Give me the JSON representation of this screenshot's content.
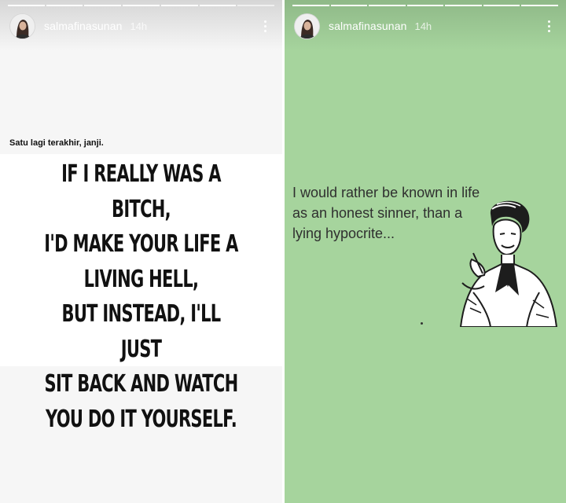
{
  "stories": [
    {
      "username": "salmafinasunan",
      "time": "14h",
      "caption": "Satu lagi terakhir, janji.",
      "quote_lines": [
        "IF I REALLY WAS A BITCH,",
        "I'D MAKE YOUR LIFE A",
        "LIVING HELL,",
        "BUT INSTEAD, I'LL JUST",
        "SIT BACK AND WATCH",
        "YOU DO IT YOURSELF."
      ],
      "background": "#f6f6f6"
    },
    {
      "username": "salmafinasunan",
      "time": "14h",
      "text_lines": [
        "I would rather be known in life",
        "as an honest sinner, than a",
        "lying hypocrite..."
      ],
      "background": "#a6d49d"
    }
  ],
  "icons": [
    "avatar",
    "more-options-icon"
  ]
}
